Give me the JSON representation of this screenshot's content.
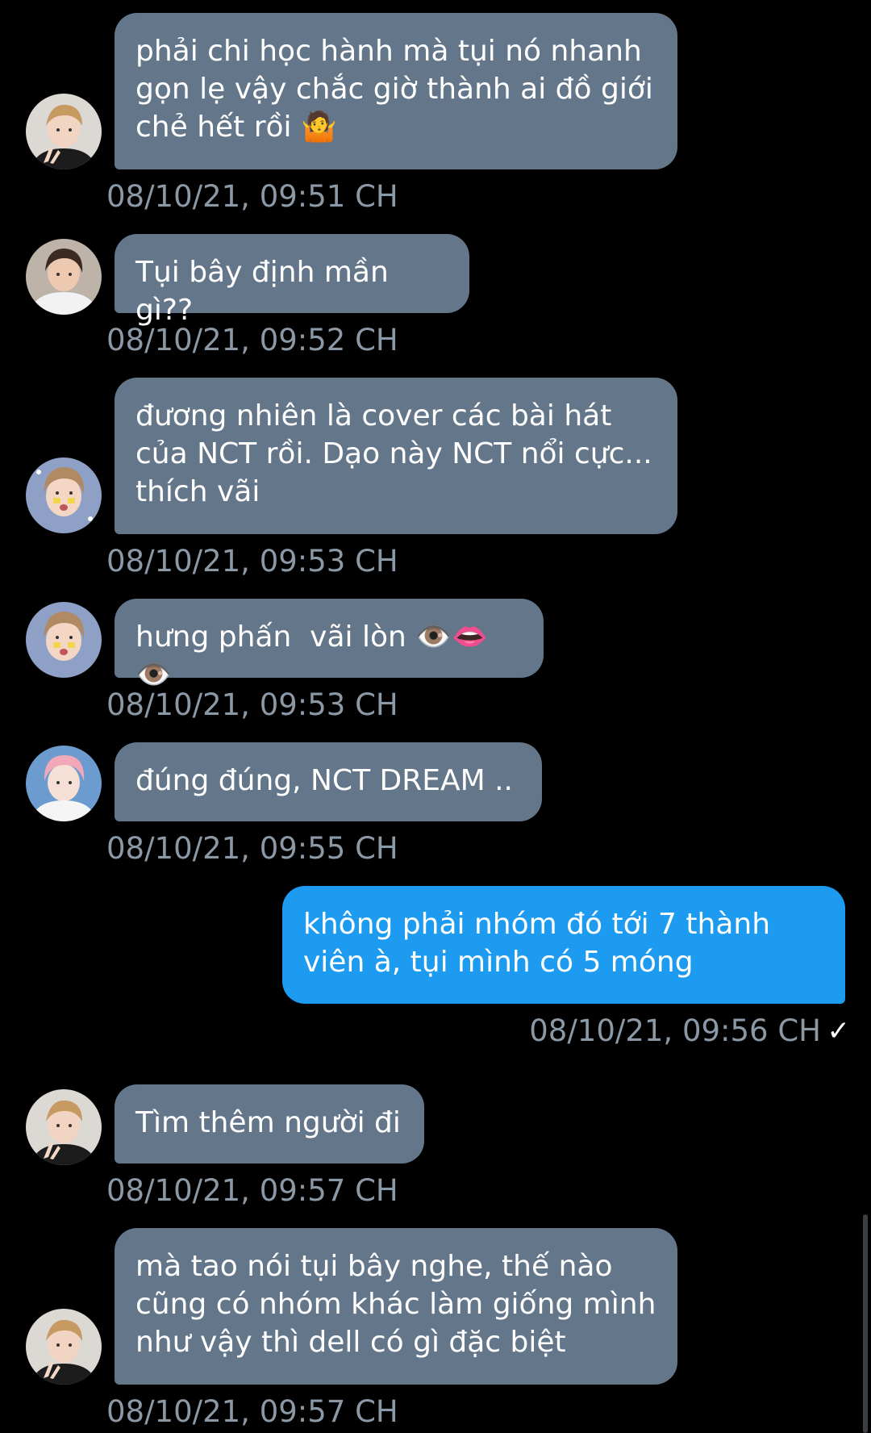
{
  "messages": [
    {
      "side": "in",
      "text": "phải chi học hành mà tụi nó nhanh\ngọn lẹ vậy chắc giờ thành ai đồ giới\nchẻ hết rồi 🤷",
      "time": "08/10/21, 09:51 CH",
      "avatar": "avatar-boy-peace"
    },
    {
      "side": "in",
      "text": "Tụi bây định mần gì??",
      "time": "08/10/21, 09:52 CH",
      "avatar": "avatar-boy-white-hoodie"
    },
    {
      "side": "in",
      "text": "đương nhiên là cover các bài hát\ncủa NCT rồi. Dạo này NCT nổi cực...\nthích vãi",
      "time": "08/10/21, 09:53 CH",
      "avatar": "avatar-boy-stickers"
    },
    {
      "side": "in",
      "text": "hưng phấn  vãi lòn 👁️👄👁️",
      "time": "08/10/21, 09:53 CH",
      "avatar": "avatar-boy-stickers"
    },
    {
      "side": "in",
      "text": "đúng đúng, NCT DREAM ..",
      "time": "08/10/21, 09:55 CH",
      "avatar": "avatar-boy-pink-hair"
    },
    {
      "side": "out",
      "text": "không phải nhóm đó tới 7 thành\nviên à, tụi mình có 5 móng",
      "time": "08/10/21, 09:56 CH",
      "status": "✓"
    },
    {
      "side": "in",
      "text": "Tìm thêm người đi",
      "time": "08/10/21, 09:57 CH",
      "avatar": "avatar-boy-peace"
    },
    {
      "side": "in",
      "text": "mà tao nói tụi bây nghe, thế nào\ncũng có nhóm khác làm giống mình\nnhư vậy thì dell có gì đặc biệt",
      "time": "08/10/21, 09:57 CH",
      "avatar": "avatar-boy-peace"
    }
  ],
  "colors": {
    "background": "#000000",
    "incoming_bubble": "#64768a",
    "outgoing_bubble": "#1d9bf0",
    "timestamp": "#8b98a5",
    "text": "#ffffff"
  }
}
